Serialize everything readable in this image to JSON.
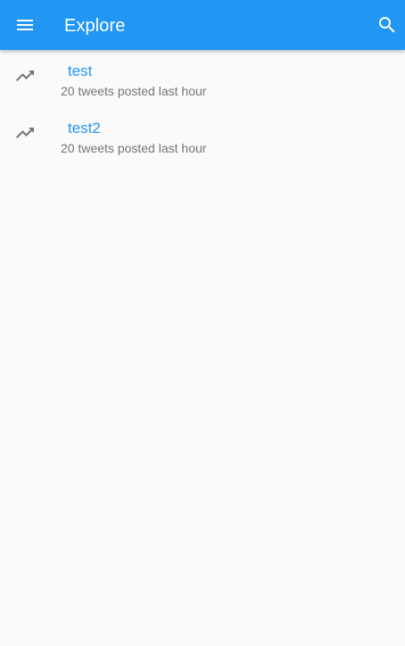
{
  "app_bar": {
    "title": "Explore",
    "menu_icon": "menu-icon",
    "search_icon": "search-icon",
    "color": "#2196f3"
  },
  "trends": [
    {
      "label": "test",
      "subtitle": "20 tweets posted last hour",
      "icon": "trending-up-icon"
    },
    {
      "label": "test2",
      "subtitle": "20 tweets posted last hour",
      "icon": "trending-up-icon"
    }
  ]
}
